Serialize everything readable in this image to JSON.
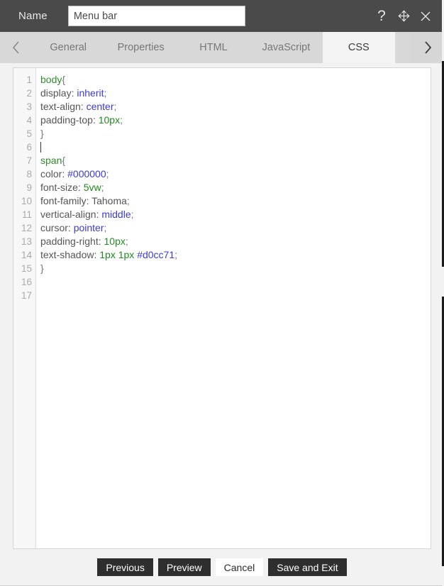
{
  "window": {
    "name_label": "Name",
    "name_value": "Menu bar",
    "name_placeholder": "Name",
    "icons": {
      "help": "help-icon",
      "move": "move-icon",
      "close": "close-icon"
    }
  },
  "tabbar": {
    "prev_arrow": "chevron-left-icon",
    "next_arrow": "chevron-right-icon",
    "tabs": [
      {
        "label": "General",
        "active": false
      },
      {
        "label": "Properties",
        "active": false
      },
      {
        "label": "HTML",
        "active": false
      },
      {
        "label": "JavaScript",
        "active": false
      },
      {
        "label": "CSS",
        "active": true
      }
    ]
  },
  "editor": {
    "language": "CSS",
    "line_numbers": [
      1,
      2,
      3,
      4,
      5,
      6,
      7,
      8,
      9,
      10,
      11,
      12,
      13,
      14,
      15,
      16,
      17
    ],
    "cursor_line": 6,
    "lines": [
      {
        "n": 1,
        "tokens": [
          {
            "t": "sel",
            "s": "body"
          },
          {
            "t": "punc",
            "s": "{"
          }
        ]
      },
      {
        "n": 2,
        "tokens": [
          {
            "t": "prop",
            "s": "display: "
          },
          {
            "t": "val",
            "s": "inherit"
          },
          {
            "t": "punc",
            "s": ";"
          }
        ]
      },
      {
        "n": 3,
        "tokens": [
          {
            "t": "prop",
            "s": "text-align: "
          },
          {
            "t": "val",
            "s": "center"
          },
          {
            "t": "punc",
            "s": ";"
          }
        ]
      },
      {
        "n": 4,
        "tokens": [
          {
            "t": "prop",
            "s": "padding-top: "
          },
          {
            "t": "num",
            "s": "10px"
          },
          {
            "t": "punc",
            "s": ";"
          }
        ]
      },
      {
        "n": 5,
        "tokens": [
          {
            "t": "punc",
            "s": "}"
          }
        ]
      },
      {
        "n": 6,
        "tokens": []
      },
      {
        "n": 7,
        "tokens": [
          {
            "t": "sel",
            "s": "span"
          },
          {
            "t": "punc",
            "s": "{"
          }
        ]
      },
      {
        "n": 8,
        "tokens": [
          {
            "t": "prop",
            "s": "color: "
          },
          {
            "t": "val",
            "s": "#000000"
          },
          {
            "t": "punc",
            "s": ";"
          }
        ]
      },
      {
        "n": 9,
        "tokens": [
          {
            "t": "prop",
            "s": "font-size: "
          },
          {
            "t": "num",
            "s": "5vw"
          },
          {
            "t": "punc",
            "s": ";"
          }
        ]
      },
      {
        "n": 10,
        "tokens": [
          {
            "t": "prop",
            "s": "font-family: "
          },
          {
            "t": "plain",
            "s": "Tahoma"
          },
          {
            "t": "punc",
            "s": ";"
          }
        ]
      },
      {
        "n": 11,
        "tokens": [
          {
            "t": "prop",
            "s": "vertical-align: "
          },
          {
            "t": "val",
            "s": "middle"
          },
          {
            "t": "punc",
            "s": ";"
          }
        ]
      },
      {
        "n": 12,
        "tokens": [
          {
            "t": "prop",
            "s": "cursor: "
          },
          {
            "t": "val",
            "s": "pointer"
          },
          {
            "t": "punc",
            "s": ";"
          }
        ]
      },
      {
        "n": 13,
        "tokens": [
          {
            "t": "prop",
            "s": "padding-right: "
          },
          {
            "t": "num",
            "s": "10px"
          },
          {
            "t": "punc",
            "s": ";"
          }
        ]
      },
      {
        "n": 14,
        "tokens": [
          {
            "t": "prop",
            "s": "text-shadow: "
          },
          {
            "t": "num",
            "s": "1px 1px "
          },
          {
            "t": "val",
            "s": "#d0cc71"
          },
          {
            "t": "punc",
            "s": ";"
          }
        ]
      },
      {
        "n": 15,
        "tokens": [
          {
            "t": "punc",
            "s": "}"
          }
        ]
      },
      {
        "n": 16,
        "tokens": []
      },
      {
        "n": 17,
        "tokens": []
      }
    ]
  },
  "footer": {
    "buttons": [
      {
        "label": "Previous",
        "style": "dark"
      },
      {
        "label": "Preview",
        "style": "dark"
      },
      {
        "label": "Cancel",
        "style": "light"
      },
      {
        "label": "Save and Exit",
        "style": "dark"
      }
    ]
  },
  "colors": {
    "titlebar_bg": "#4a4a4a",
    "tabbar_bg": "#d8d8d8",
    "active_tab_bg": "#f4f4f4",
    "editor_bg": "#ffffff",
    "gutter_bg": "#f7f7f7",
    "button_dark_bg": "#2e2e2e",
    "syntax_selector": "#2e8b2e",
    "syntax_value": "#3b3bd4",
    "syntax_number": "#1f8a1f",
    "syntax_property": "#555555"
  }
}
